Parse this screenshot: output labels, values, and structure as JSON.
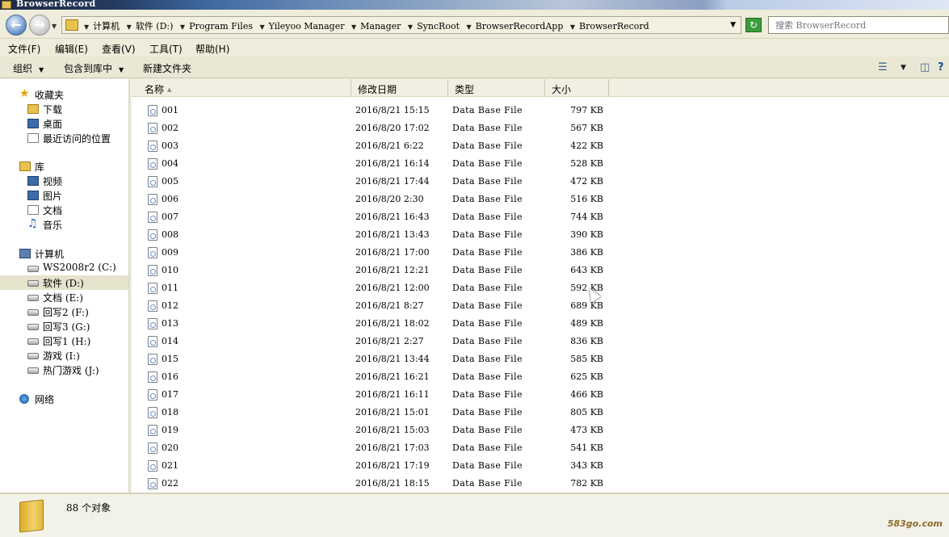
{
  "window": {
    "title": "BrowserRecord"
  },
  "address": {
    "crumbs": [
      "计算机",
      "软件 (D:)",
      "Program Files",
      "Yileyoo Manager",
      "Manager",
      "SyncRoot",
      "BrowserRecordApp",
      "BrowserRecord"
    ],
    "search_placeholder": "搜索 BrowserRecord"
  },
  "menu": {
    "file": "文件(F)",
    "edit": "编辑(E)",
    "view": "查看(V)",
    "tools": "工具(T)",
    "help": "帮助(H)"
  },
  "toolbar": {
    "organize": "组织",
    "include_library": "包含到库中",
    "new_folder": "新建文件夹"
  },
  "sidebar": {
    "favorites": {
      "label": "收藏夹",
      "items": [
        "下载",
        "桌面",
        "最近访问的位置"
      ]
    },
    "libraries": {
      "label": "库",
      "items": [
        "视频",
        "图片",
        "文档",
        "音乐"
      ]
    },
    "computer": {
      "label": "计算机",
      "drives": [
        "WS2008r2 (C:)",
        "软件 (D:)",
        "文档 (E:)",
        "回写2 (F:)",
        "回写3 (G:)",
        "回写1 (H:)",
        "游戏 (I:)",
        "热门游戏 (J:)"
      ]
    },
    "network": {
      "label": "网络"
    }
  },
  "columns": {
    "name": "名称",
    "date": "修改日期",
    "type": "类型",
    "size": "大小"
  },
  "files": [
    {
      "name": "001",
      "date": "2016/8/21 15:15",
      "type": "Data Base File",
      "size": "797 KB"
    },
    {
      "name": "002",
      "date": "2016/8/20 17:02",
      "type": "Data Base File",
      "size": "567 KB"
    },
    {
      "name": "003",
      "date": "2016/8/21 6:22",
      "type": "Data Base File",
      "size": "422 KB"
    },
    {
      "name": "004",
      "date": "2016/8/21 16:14",
      "type": "Data Base File",
      "size": "528 KB"
    },
    {
      "name": "005",
      "date": "2016/8/21 17:44",
      "type": "Data Base File",
      "size": "472 KB"
    },
    {
      "name": "006",
      "date": "2016/8/20 2:30",
      "type": "Data Base File",
      "size": "516 KB"
    },
    {
      "name": "007",
      "date": "2016/8/21 16:43",
      "type": "Data Base File",
      "size": "744 KB"
    },
    {
      "name": "008",
      "date": "2016/8/21 13:43",
      "type": "Data Base File",
      "size": "390 KB"
    },
    {
      "name": "009",
      "date": "2016/8/21 17:00",
      "type": "Data Base File",
      "size": "386 KB"
    },
    {
      "name": "010",
      "date": "2016/8/21 12:21",
      "type": "Data Base File",
      "size": "643 KB"
    },
    {
      "name": "011",
      "date": "2016/8/21 12:00",
      "type": "Data Base File",
      "size": "592 KB"
    },
    {
      "name": "012",
      "date": "2016/8/21 8:27",
      "type": "Data Base File",
      "size": "689 KB"
    },
    {
      "name": "013",
      "date": "2016/8/21 18:02",
      "type": "Data Base File",
      "size": "489 KB"
    },
    {
      "name": "014",
      "date": "2016/8/21 2:27",
      "type": "Data Base File",
      "size": "836 KB"
    },
    {
      "name": "015",
      "date": "2016/8/21 13:44",
      "type": "Data Base File",
      "size": "585 KB"
    },
    {
      "name": "016",
      "date": "2016/8/21 16:21",
      "type": "Data Base File",
      "size": "625 KB"
    },
    {
      "name": "017",
      "date": "2016/8/21 16:11",
      "type": "Data Base File",
      "size": "466 KB"
    },
    {
      "name": "018",
      "date": "2016/8/21 15:01",
      "type": "Data Base File",
      "size": "805 KB"
    },
    {
      "name": "019",
      "date": "2016/8/21 15:03",
      "type": "Data Base File",
      "size": "473 KB"
    },
    {
      "name": "020",
      "date": "2016/8/21 17:03",
      "type": "Data Base File",
      "size": "541 KB"
    },
    {
      "name": "021",
      "date": "2016/8/21 17:19",
      "type": "Data Base File",
      "size": "343 KB"
    },
    {
      "name": "022",
      "date": "2016/8/21 18:15",
      "type": "Data Base File",
      "size": "782 KB"
    }
  ],
  "status": {
    "count_text": "88 个对象"
  },
  "watermark": "583go.com"
}
